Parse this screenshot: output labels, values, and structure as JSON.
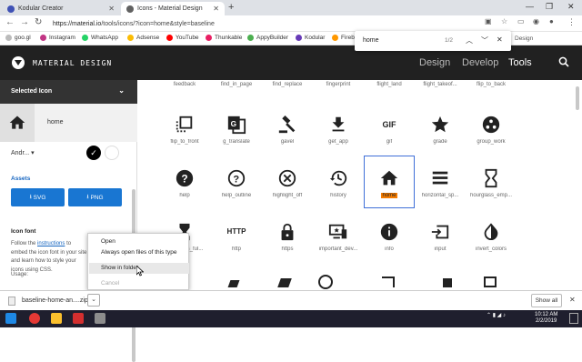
{
  "tabs": [
    {
      "title": "Kodular Creator",
      "active": false
    },
    {
      "title": "Icons - Material Design",
      "active": true
    }
  ],
  "toolbar": {
    "url_host": "https://material.io",
    "url_path": "/tools/icons/?icon=home&style=baseline"
  },
  "bookmarks": [
    "goo.gl",
    "Instagram",
    "WhatsApp",
    "Adsense",
    "YouTube",
    "Thunkable",
    "AppyBuilder",
    "Kodular",
    "Fireb"
  ],
  "findbar": {
    "query": "home",
    "count": "1/2",
    "trailing": "Design"
  },
  "header": {
    "title": "MATERIAL DESIGN",
    "nav": [
      {
        "label": "Design",
        "active": false
      },
      {
        "label": "Develop",
        "active": false
      },
      {
        "label": "Tools",
        "active": true
      }
    ]
  },
  "sidebar": {
    "selected_label": "Selected Icon",
    "icon_name": "home",
    "platform": "Andr...",
    "assets_label": "Assets",
    "svg_button": "SVG",
    "png_button": "PNG",
    "icon_font_label": "Icon font",
    "follow_pre": "Follow the",
    "follow_link": "instructions",
    "follow_post": "to embed the icon font in your site and learn how to style your icons using CSS.",
    "usage_label": "Usage:"
  },
  "grid": {
    "top_labels": [
      "feedback",
      "find_in_page",
      "find_replace",
      "fingerprint",
      "flight_land",
      "flight_takeof...",
      "flip_to_back"
    ],
    "row1": [
      "flip_to_front",
      "g_translate",
      "gavel",
      "get_app",
      "gif",
      "grade",
      "group_work"
    ],
    "row2": [
      "help",
      "help_outline",
      "highlight_off",
      "history",
      "home",
      "horizontal_sp...",
      "hourglass_emp..."
    ],
    "row3": [
      "hourglass_ful...",
      "http",
      "https",
      "important_dev...",
      "info",
      "input",
      "invert_colors"
    ],
    "gif_text": "GIF",
    "http_text": "HTTP"
  },
  "context_menu": {
    "items": [
      {
        "label": "Open",
        "disabled": false
      },
      {
        "label": "Always open files of this type",
        "disabled": false
      },
      {
        "label": "Show in folder",
        "disabled": false
      },
      {
        "label": "Cancel",
        "disabled": true
      }
    ]
  },
  "downloads": {
    "file": "baseline-home-an....zip",
    "show_all": "Show all"
  },
  "taskbar": {
    "time": "10:12 AM",
    "date": "2/2/2019"
  },
  "colors": {
    "header_bg": "#212121",
    "accent_blue": "#1976d2",
    "highlight": "#f57c00"
  }
}
